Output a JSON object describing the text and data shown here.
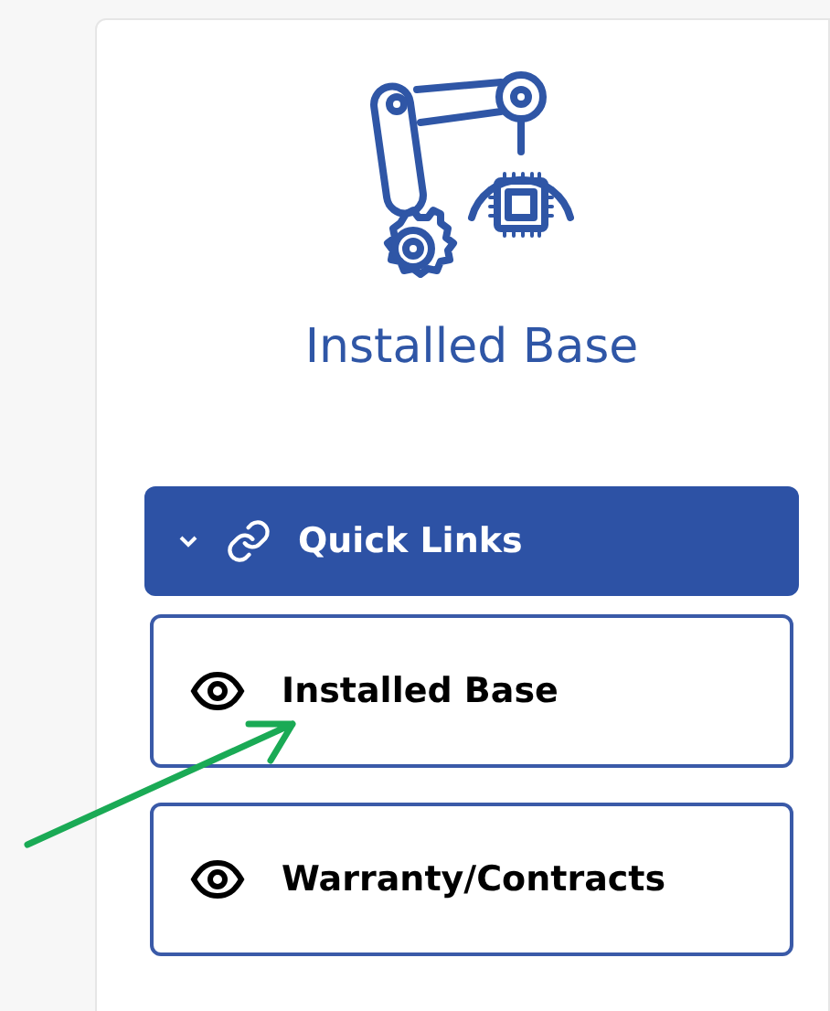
{
  "title": "Installed Base",
  "quick_links": {
    "label": "Quick Links",
    "expanded": true
  },
  "links": [
    {
      "label": "Installed Base"
    },
    {
      "label": "Warranty/Contracts"
    }
  ]
}
